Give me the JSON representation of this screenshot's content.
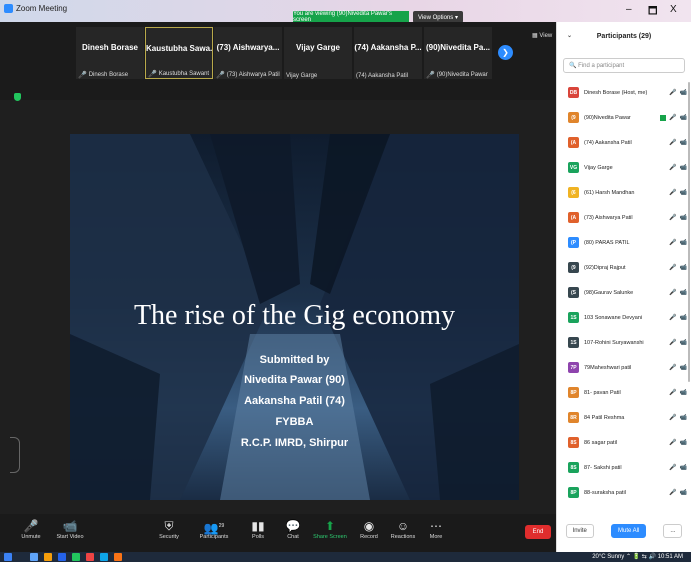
{
  "window": {
    "title": "Zoom Meeting",
    "viewing_label": "You are viewing (90)Nivedita Pawar's screen",
    "view_options": "View Options ▾",
    "minimize": "–",
    "maximize": "🗖",
    "close": "X"
  },
  "video_strip": {
    "view_label": "View",
    "tiles": [
      {
        "name": "Dinesh Borase",
        "label": "Dinesh Borase"
      },
      {
        "name": "Kaustubha Sawa...",
        "label": "Kaustubha Sawant"
      },
      {
        "name": "(73) Aishwarya...",
        "label": "(73) Aishwarya Patil"
      },
      {
        "name": "Vijay Garge",
        "label": "Vijay Garge"
      },
      {
        "name": "(74) Aakansha P...",
        "label": "(74) Aakansha Patil"
      },
      {
        "name": "(90)Nivedita Pa...",
        "label": "(90)Nivedita Pawar"
      }
    ]
  },
  "slide": {
    "title": "The rise of the Gig economy",
    "lines": [
      "Submitted by",
      "Nivedita Pawar (90)",
      "Aakansha Patil (74)",
      "FYBBA",
      "R.C.P. IMRD, Shirpur"
    ]
  },
  "participants": {
    "header": "Participants (29)",
    "search_placeholder": "Find a participant",
    "list": [
      {
        "initials": "DB",
        "color": "#d9453b",
        "name": "Dinesh Borase (Host, me)"
      },
      {
        "initials": "(9",
        "color": "#e0852c",
        "name": "(90)Nivedita Pawar"
      },
      {
        "initials": "(A",
        "color": "#e0612c",
        "name": "(74) Aakansha Patil"
      },
      {
        "initials": "VG",
        "color": "#1aa35c",
        "name": "Vijay Garge"
      },
      {
        "initials": "(6",
        "color": "#f0b323",
        "name": "(61) Harsh  Mandhan"
      },
      {
        "initials": "(A",
        "color": "#e0612c",
        "name": "(73) Aishwarya Patil"
      },
      {
        "initials": "(P",
        "color": "#2d8cff",
        "name": "(80) PARAS PATIL"
      },
      {
        "initials": "(9",
        "color": "#37474f",
        "name": "(92)Dipraj Rajput"
      },
      {
        "initials": "(S",
        "color": "#37474f",
        "name": "(98)Gaurav Salunke"
      },
      {
        "initials": "1S",
        "color": "#1aa35c",
        "name": "103 Sonawane Devyani"
      },
      {
        "initials": "1S",
        "color": "#37474f",
        "name": "107-Rohini Suryawanshi"
      },
      {
        "initials": "7P",
        "color": "#8e44ad",
        "name": "79Maheshwari patil"
      },
      {
        "initials": "8P",
        "color": "#e0852c",
        "name": "81- pavan Patil"
      },
      {
        "initials": "8R",
        "color": "#e0852c",
        "name": "84 Patil Reshma"
      },
      {
        "initials": "8S",
        "color": "#e0612c",
        "name": "86 sagar patil"
      },
      {
        "initials": "8S",
        "color": "#1aa35c",
        "name": "87- Sakshi patil"
      },
      {
        "initials": "8P",
        "color": "#1aa35c",
        "name": "88-suraksha patil"
      }
    ],
    "invite": "Invite",
    "mute_all": "Mute All",
    "more": "..."
  },
  "toolbar": {
    "unmute": "Unmute",
    "start_video": "Start Video",
    "security": "Security",
    "participants": "Participants",
    "participants_count": "29",
    "polls": "Polls",
    "chat": "Chat",
    "share_screen": "Share Screen",
    "record": "Record",
    "reactions": "Reactions",
    "more": "More",
    "end": "End"
  },
  "taskbar": {
    "weather": "20°C  Sunny",
    "time": "10:51 AM"
  }
}
